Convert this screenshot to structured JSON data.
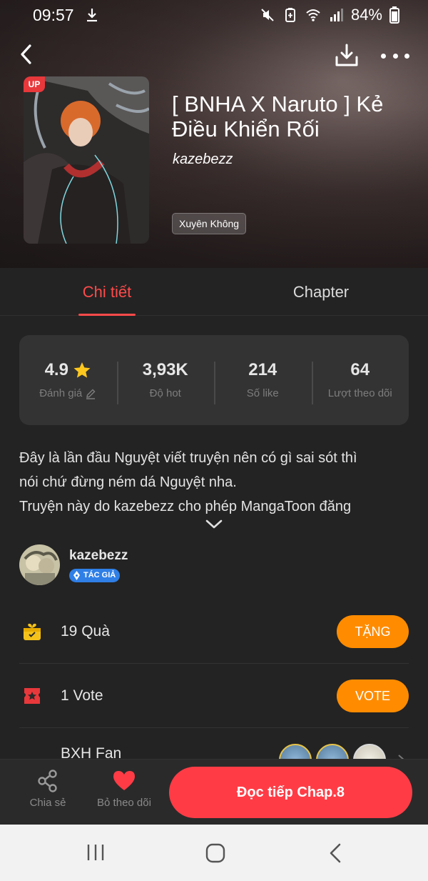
{
  "status_bar": {
    "time": "09:57",
    "battery": "84%",
    "icons": [
      "download-icon",
      "mute-icon",
      "battery-saver-icon",
      "wifi-icon",
      "signal-icon",
      "battery-icon"
    ]
  },
  "header": {
    "title": "[ BNHA X Naruto ] Kẻ Điều Khiển Rối",
    "author": "kazebezz",
    "badge": "UP",
    "genre": "Xuyên Không"
  },
  "tabs": [
    {
      "label": "Chi tiết",
      "active": true
    },
    {
      "label": "Chapter",
      "active": false
    }
  ],
  "stats": [
    {
      "value": "4.9",
      "label": "Đánh giá",
      "icon": "star-icon"
    },
    {
      "value": "3,93K",
      "label": "Độ hot"
    },
    {
      "value": "214",
      "label": "Số like"
    },
    {
      "value": "64",
      "label": "Lượt theo dõi"
    }
  ],
  "description": {
    "lines": [
      "Đây là lần đầu Nguyệt viết truyện nên có gì sai sót thì",
      "nói chứ đừng ném dá Nguyệt nha.",
      "Truyện này do kazebezz cho phép MangaToon đăng"
    ]
  },
  "author_section": {
    "name": "kazebezz",
    "badge": "TÁC GIẢ"
  },
  "rows": {
    "gift": {
      "label": "19  Quà",
      "button": "TẶNG"
    },
    "vote": {
      "label": "1  Vote",
      "button": "VOTE"
    },
    "fan": {
      "label": "BXH Fan"
    }
  },
  "bottom_bar": {
    "share": "Chia sẻ",
    "unfollow": "Bỏ theo dõi",
    "read": "Đọc tiếp Chap.8"
  },
  "colors": {
    "accent_red": "#ff4a4a",
    "orange": "#ff8c00",
    "read_button": "#ff3c46",
    "background": "#232323"
  }
}
